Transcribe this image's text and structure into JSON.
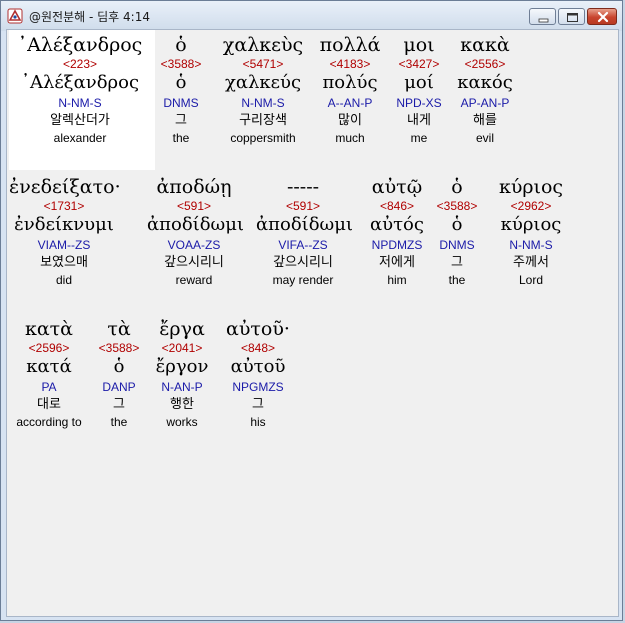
{
  "window": {
    "title": "@원전분해 - 딤후 4:14"
  },
  "words": [
    {
      "greek": "᾿Αλέξανδρος",
      "strong": "<223>",
      "lemma": "᾿Αλέξανδρος",
      "parse": "N-NM-S",
      "korean": "알렉산더가",
      "english": "alexander"
    },
    {
      "greek": "ὁ",
      "strong": "<3588>",
      "lemma": "ὁ",
      "parse": "DNMS",
      "korean": "그",
      "english": "the"
    },
    {
      "greek": "χαλκεὺς",
      "strong": "<5471>",
      "lemma": "χαλκεύς",
      "parse": "N-NM-S",
      "korean": "구리장색",
      "english": "coppersmith"
    },
    {
      "greek": "πολλά",
      "strong": "<4183>",
      "lemma": "πολύς",
      "parse": "A--AN-P",
      "korean": "많이",
      "english": "much"
    },
    {
      "greek": "μοι",
      "strong": "<3427>",
      "lemma": "μοί",
      "parse": "NPD-XS",
      "korean": "내게",
      "english": "me"
    },
    {
      "greek": "κακὰ",
      "strong": "<2556>",
      "lemma": "κακός",
      "parse": "AP-AN-P",
      "korean": "해를",
      "english": "evil"
    },
    {
      "greek": "ἐνεδείξατο·",
      "strong": "<1731>",
      "lemma": "ἐνδείκνυμι",
      "parse": "VIAM--ZS",
      "korean": "보였으매",
      "english": "did"
    },
    {
      "greek": "ἀποδώῃ",
      "strong": "<591>",
      "lemma": "ἀποδίδωμι",
      "parse": "VOAA-ZS",
      "korean": "갚으시리니",
      "english": "reward"
    },
    {
      "greek": "-----",
      "strong": "<591>",
      "lemma": "ἀποδίδωμι",
      "parse": "VIFA--ZS",
      "korean": "갚으시리니",
      "english": "may render"
    },
    {
      "greek": "αὐτῷ",
      "strong": "<846>",
      "lemma": "αὐτός",
      "parse": "NPDMZS",
      "korean": "저에게",
      "english": "him"
    },
    {
      "greek": "ὁ",
      "strong": "<3588>",
      "lemma": "ὁ",
      "parse": "DNMS",
      "korean": "그",
      "english": "the"
    },
    {
      "greek": "κύριος",
      "strong": "<2962>",
      "lemma": "κύριος",
      "parse": "N-NM-S",
      "korean": "주께서",
      "english": "Lord"
    },
    {
      "greek": "κατὰ",
      "strong": "<2596>",
      "lemma": "κατά",
      "parse": "PA",
      "korean": "대로",
      "english": "according to"
    },
    {
      "greek": "τὰ",
      "strong": "<3588>",
      "lemma": "ὁ",
      "parse": "DANP",
      "korean": "그",
      "english": "the"
    },
    {
      "greek": "ἔργα",
      "strong": "<2041>",
      "lemma": "ἔργον",
      "parse": "N-AN-P",
      "korean": "행한",
      "english": "works"
    },
    {
      "greek": "αὐτοῦ·",
      "strong": "<848>",
      "lemma": "αὐτοῦ",
      "parse": "NPGMZS",
      "korean": "그",
      "english": "his"
    }
  ]
}
